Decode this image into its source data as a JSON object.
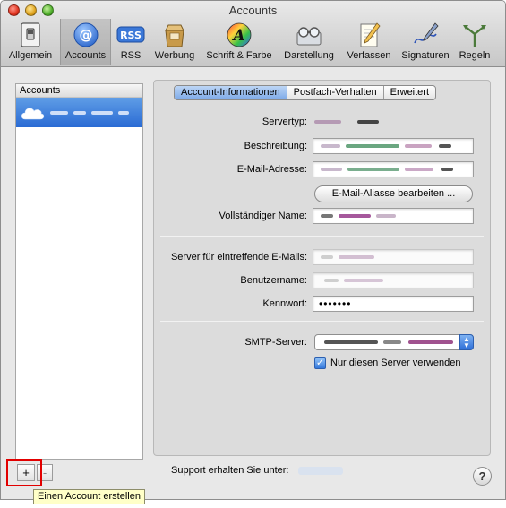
{
  "window": {
    "title": "Accounts"
  },
  "toolbar": {
    "items": [
      {
        "label": "Allgemein",
        "icon": "general-switch-icon"
      },
      {
        "label": "Accounts",
        "icon": "at-sign-icon",
        "selected": true
      },
      {
        "label": "RSS",
        "icon": "rss-icon"
      },
      {
        "label": "Werbung",
        "icon": "junk-mail-icon"
      },
      {
        "label": "Schrift & Farbe",
        "icon": "font-color-icon"
      },
      {
        "label": "Darstellung",
        "icon": "viewing-icon"
      },
      {
        "label": "Verfassen",
        "icon": "composing-icon"
      },
      {
        "label": "Signaturen",
        "icon": "signature-icon"
      },
      {
        "label": "Regeln",
        "icon": "rules-icon"
      }
    ]
  },
  "sidebar": {
    "header": "Accounts"
  },
  "tabs": [
    "Account-Informationen",
    "Postfach-Verhalten",
    "Erweitert"
  ],
  "form": {
    "server_type_label": "Servertyp:",
    "description_label": "Beschreibung:",
    "email_label": "E-Mail-Adresse:",
    "alias_button": "E-Mail-Aliasse bearbeiten ...",
    "full_name_label": "Vollständiger Name:",
    "incoming_server_label": "Server für eintreffende E-Mails:",
    "username_label": "Benutzername:",
    "password_label": "Kennwort:",
    "password_value": "•••••••",
    "smtp_label": "SMTP-Server:",
    "smtp_checkbox_label": "Nur diesen Server verwenden",
    "smtp_checkbox_checked": true
  },
  "footer": {
    "add_button": "+",
    "remove_button": "-",
    "support_text": "Support erhalten Sie unter:",
    "help_button": "?"
  },
  "tooltip": {
    "text": "Einen Account erstellen"
  },
  "colors": {
    "selection_blue": "#2a6bd4",
    "highlight_red": "#e20000",
    "tooltip_bg": "#ffffc8"
  }
}
